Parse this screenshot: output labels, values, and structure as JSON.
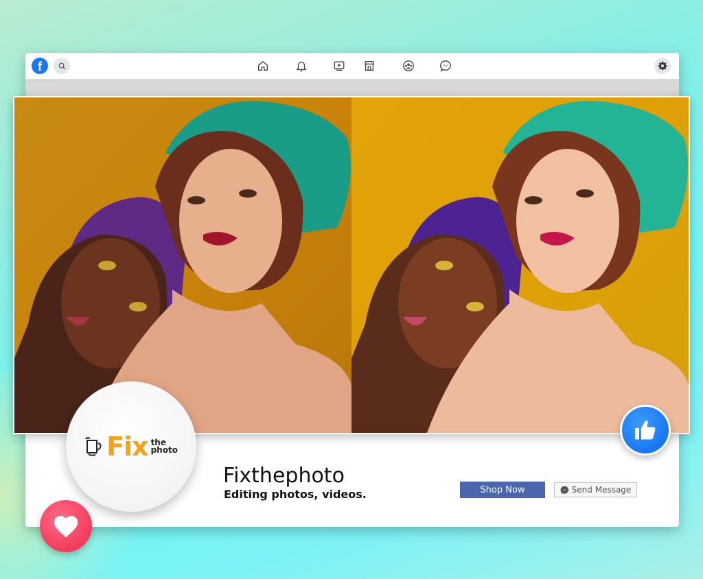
{
  "nav": {
    "logo_icon": "facebook-logo-icon",
    "logo_letter": "f",
    "search_icon": "search-icon",
    "items": [
      {
        "name": "home-icon"
      },
      {
        "name": "bell-icon"
      },
      {
        "name": "watch-video-icon"
      },
      {
        "name": "marketplace-icon"
      },
      {
        "name": "groups-icon"
      },
      {
        "name": "messenger-icon"
      }
    ],
    "settings_icon": "gear-icon"
  },
  "cover": {
    "before_label": "",
    "after_label": ""
  },
  "profile": {
    "brand_main": "Fix",
    "brand_the": "the",
    "brand_photo": "photo",
    "name": "Fixthephoto",
    "description": "Editing photos, videos."
  },
  "actions": {
    "shop_label": "Shop Now",
    "message_label": "Send Message"
  },
  "badges": {
    "like_icon": "thumbs-up-icon",
    "heart_icon": "heart-icon"
  },
  "colors": {
    "facebook_blue": "#1877f2",
    "shop_button": "#4a67ad",
    "brand_orange": "#f3a31a",
    "heart_red": "#f33b5c"
  }
}
